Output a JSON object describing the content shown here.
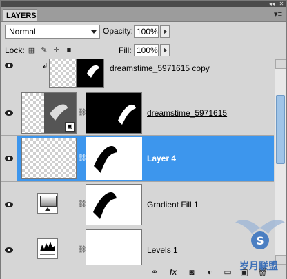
{
  "panel": {
    "title": "LAYERS",
    "blend_mode": "Normal",
    "opacity_label": "Opacity:",
    "opacity_value": "100%",
    "lock_label": "Lock:",
    "fill_label": "Fill:",
    "fill_value": "100%"
  },
  "layers": [
    {
      "name": "dreamstime_5971615 copy",
      "visible": true,
      "selected": false
    },
    {
      "name": "dreamstime_5971615",
      "visible": true,
      "selected": false
    },
    {
      "name": "Layer 4",
      "visible": true,
      "selected": true
    },
    {
      "name": "Gradient Fill 1",
      "visible": true,
      "selected": false
    },
    {
      "name": "Levels 1",
      "visible": true,
      "selected": false
    }
  ],
  "colors": {
    "selection": "#3d96ed",
    "panel_bg": "#d6d6d6"
  },
  "watermark": {
    "text": "岁月联盟"
  }
}
